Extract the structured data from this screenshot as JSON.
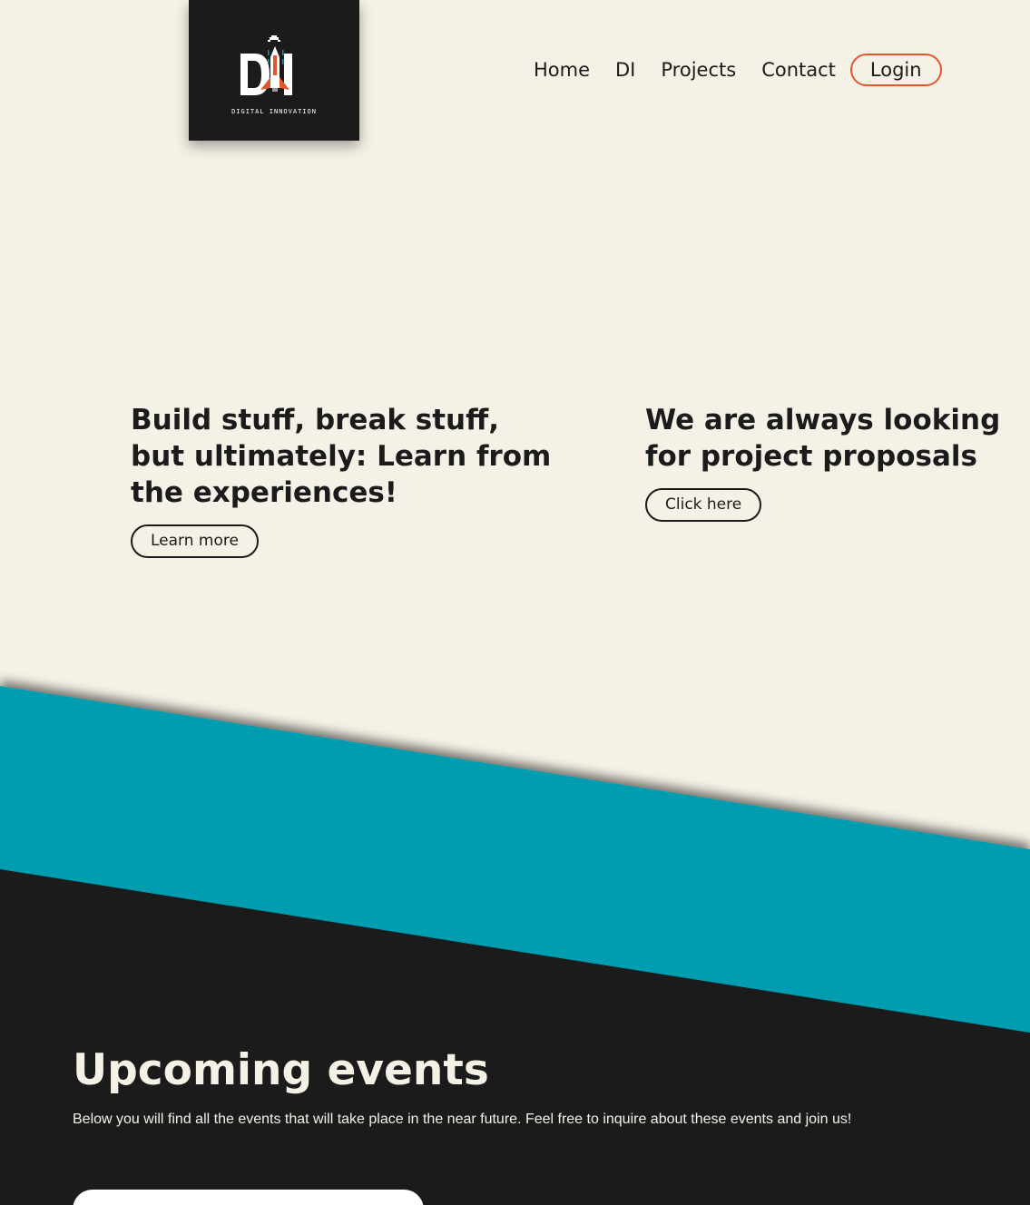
{
  "brand": {
    "logo_caption": "DIGITAL INNOVATION",
    "logo_letters": "DI",
    "colors": {
      "logo_bg": "#1b1b1b",
      "logo_fg": "#ffffff",
      "accent_red": "#e0572d",
      "accent_teal": "#009db0"
    }
  },
  "nav": {
    "items": [
      {
        "label": "Home"
      },
      {
        "label": "DI"
      },
      {
        "label": "Projects"
      },
      {
        "label": "Contact"
      }
    ],
    "login_label": "Login"
  },
  "hero": {
    "left": {
      "heading": "Build stuff, break stuff, but ultimately: Learn from the experiences!",
      "button_label": "Learn more"
    },
    "right": {
      "heading": "We are always looking for project proposals",
      "button_label": "Click here"
    }
  },
  "events": {
    "title": "Upcoming events",
    "description": "Below you will find all the events that will take place in the near future. Feel free to inquire about these events and join us!"
  },
  "colors": {
    "page_bg": "#f5f1e6",
    "text_dark": "#1b1b1b",
    "band_teal": "#009db0",
    "footer_dark": "#1b1b1b"
  }
}
